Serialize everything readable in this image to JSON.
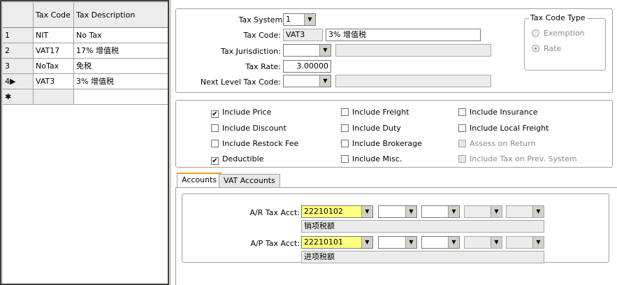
{
  "grid": {
    "columns": [
      "",
      "Tax Code",
      "Tax Description"
    ],
    "rows": [
      {
        "num": "1",
        "code": "NIT",
        "desc": "No Tax"
      },
      {
        "num": "2",
        "code": "VAT17",
        "desc": "17% 增值税"
      },
      {
        "num": "3",
        "code": "NoTax",
        "desc": "免税"
      },
      {
        "num": "4▶",
        "code": "VAT3",
        "desc": "3% 增值税"
      }
    ],
    "new_row": "✱"
  },
  "form": {
    "tax_system_label": "Tax System:",
    "tax_system_value": "1",
    "tax_code_label": "Tax Code:",
    "tax_code_value": "VAT3",
    "tax_code_desc": "3% 增值税",
    "tax_jurisdiction_label": "Tax Jurisdiction:",
    "tax_rate_label": "Tax Rate:",
    "tax_rate_value": "3.00000",
    "next_level_label": "Next Level Tax Code:"
  },
  "tax_code_type": {
    "title": "Tax Code Type",
    "exemption": "Exemption",
    "rate": "Rate"
  },
  "checks": {
    "include_price": "Include Price",
    "include_discount": "Include Discount",
    "include_restock_fee": "Include Restock Fee",
    "deductible": "Deductible",
    "include_freight": "Include Freight",
    "include_duty": "Include Duty",
    "include_brokerage": "Include Brokerage",
    "include_misc": "Include Misc.",
    "include_insurance": "Include Insurance",
    "include_local_freight": "Include Local Freight",
    "assess_on_return": "Assess on Return",
    "include_tax_prev": "Include Tax on Prev. System"
  },
  "tabs": {
    "accounts": "Accounts",
    "vat_accounts": "VAT Accounts"
  },
  "accounts": {
    "ar_label": "A/R Tax Acct:",
    "ar_value": "22210102",
    "ar_desc": "销项税额",
    "ap_label": "A/P Tax Acct:",
    "ap_value": "22210101",
    "ap_desc": "进项税额"
  },
  "icons": {
    "dropdown": "▼",
    "check": "✔"
  }
}
